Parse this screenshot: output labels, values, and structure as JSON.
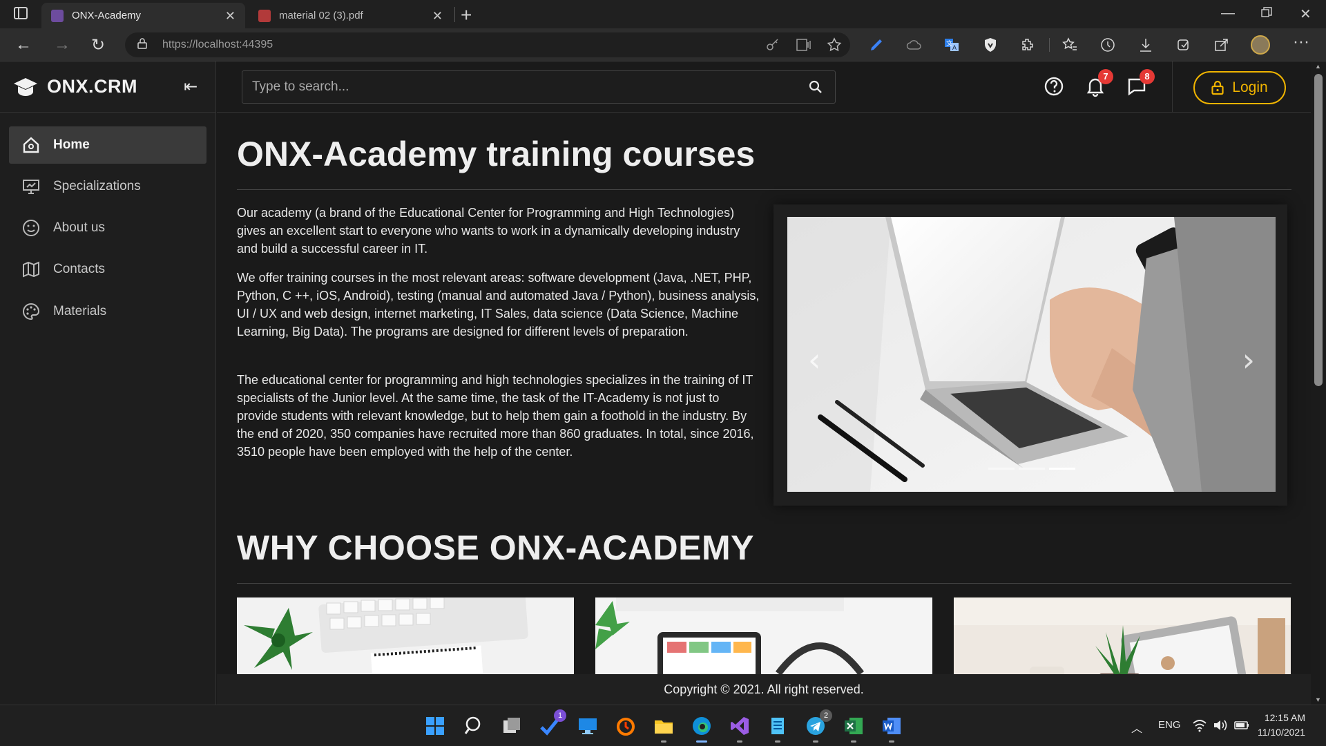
{
  "browser": {
    "tabs": [
      {
        "title": "ONX-Academy",
        "active": true
      },
      {
        "title": "material 02 (3).pdf",
        "active": false
      }
    ],
    "url_host": "https://localhost",
    "url_port": ":44395"
  },
  "app": {
    "brand": "ONX.CRM",
    "search_placeholder": "Type to search...",
    "notifications_count": "7",
    "messages_count": "8",
    "login_label": "Login",
    "accent": "#f0b400"
  },
  "sidebar": {
    "items": [
      {
        "label": "Home",
        "icon": "home-icon",
        "active": true
      },
      {
        "label": "Specializations",
        "icon": "presentation-icon",
        "active": false
      },
      {
        "label": "About us",
        "icon": "smile-icon",
        "active": false
      },
      {
        "label": "Contacts",
        "icon": "map-icon",
        "active": false
      },
      {
        "label": "Materials",
        "icon": "palette-icon",
        "active": false
      }
    ]
  },
  "main": {
    "title": "ONX-Academy training courses",
    "paragraphs": [
      "Our academy (a brand of the Educational Center for Programming and High Technologies) gives an excellent start to everyone who wants to work in a dynamically developing industry and build a successful career in IT.",
      "We offer training courses in the most relevant areas: software development (Java, .NET, PHP, Python, C ++, iOS, Android), testing (manual and automated Java / Python), business analysis, UI / UX and web design, internet marketing, IT Sales, data science (Data Science, Machine Learning, Big Data). The programs are designed for different levels of preparation.",
      "The educational center for programming and high technologies specializes in the training of IT specialists of the Junior level. At the same time, the task of the IT-Academy is not just to provide students with relevant knowledge, but to help them gain a foothold in the industry. By the end of 2020, 350 companies have recruited more than 860 graduates. In total, since 2016, 3510 people have been employed with the help of the center."
    ],
    "carousel": {
      "slides": 3,
      "active_slide": 3
    },
    "why_title": "WHY CHOOSE ONX-ACADEMY"
  },
  "footer": {
    "text": "Copyright © 2021. All right reserved."
  },
  "taskbar": {
    "todo_badge": "1",
    "telegram_badge": "2",
    "lang": "ENG",
    "time": "12:15 AM",
    "date": "11/10/2021"
  }
}
